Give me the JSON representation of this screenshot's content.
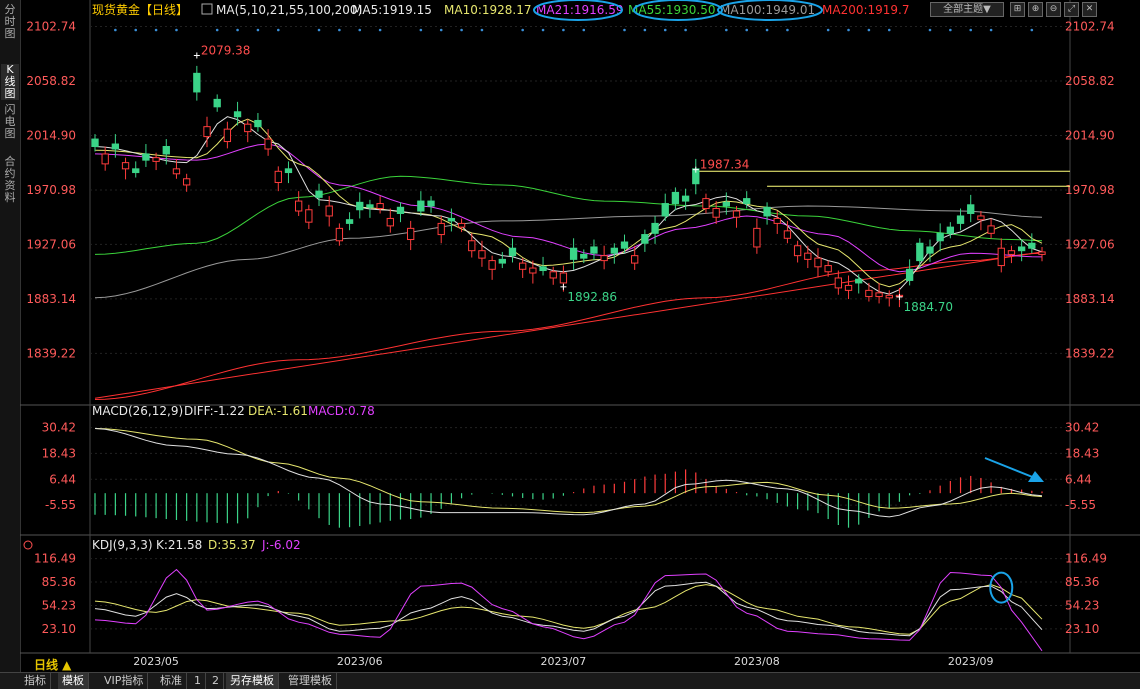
{
  "sidebar": {
    "tabs": [
      {
        "label": "分时图",
        "active": false
      },
      {
        "label": "K线图",
        "active": true
      },
      {
        "label": "闪电图",
        "active": false
      },
      {
        "label": "合约资料",
        "active": false
      }
    ]
  },
  "bottom_bar": {
    "tabs": [
      {
        "label": "指标",
        "active": false
      },
      {
        "label": "模板",
        "active": true
      },
      {
        "label": "VIP指标",
        "active": false
      },
      {
        "label": "标准",
        "active": false
      },
      {
        "label": "1",
        "active": false
      },
      {
        "label": "2",
        "active": false
      },
      {
        "label": "另存模板",
        "active": true
      },
      {
        "label": "管理模板",
        "active": false
      }
    ]
  },
  "period_label": "日线 ▲",
  "theme_button": "全部主题▼",
  "tool_icons": [
    "crosshair-icon",
    "zoom-icon",
    "zoom-out-icon",
    "fullscreen-icon",
    "close-icon"
  ],
  "colors": {
    "up": "#ff3c3c",
    "down": "#3bd488",
    "ma5": "#e0e0e0",
    "ma10": "#e6e66e",
    "ma21": "#e040ff",
    "ma55": "#3bd43b",
    "ma100": "#9a9a9a",
    "ma200": "#ff3232",
    "annotation": "#1aa3e8",
    "axis_text": "#ff5a5a",
    "bg": "#000000"
  },
  "chart_data": [
    {
      "type": "candlestick",
      "title": "现货黄金【日线】",
      "ma_legend": [
        {
          "label": "MA(5,10,21,55,100,200)",
          "color": "#e8e8e8"
        },
        {
          "label": "MA5:1919.15",
          "color": "#e8e8e8"
        },
        {
          "label": "MA10:1928.17",
          "color": "#e6e66e"
        },
        {
          "label": "MA21:1916.59",
          "color": "#e040ff"
        },
        {
          "label": "MA55:1930.50",
          "color": "#3bd43b"
        },
        {
          "label": "MA100:1949.01",
          "color": "#9a9a9a"
        },
        {
          "label": "MA200:1919.7",
          "color": "#ff3232"
        }
      ],
      "x_ticks": [
        "2023/05",
        "2023/06",
        "2023/07",
        "2023/08",
        "2023/09"
      ],
      "x_tick_index": [
        6,
        26,
        46,
        65,
        86
      ],
      "y_ticks": [
        2102.74,
        2058.82,
        2014.9,
        1970.98,
        1927.06,
        1883.14,
        1839.22
      ],
      "ylim": [
        1800,
        2108
      ],
      "annotations": [
        {
          "label": "2079.38",
          "index": 10,
          "value": 2079.38
        },
        {
          "label": "1987.34",
          "index": 59,
          "value": 1987.34
        },
        {
          "label": "1892.86",
          "index": 46,
          "value": 1892.86
        },
        {
          "label": "1884.70",
          "index": 79,
          "value": 1884.7
        }
      ],
      "resistance_lines": [
        {
          "value": 1986,
          "from_index": 59
        },
        {
          "value": 1974,
          "from_index": 66
        }
      ],
      "support_line": {
        "from": [
          0,
          1803
        ],
        "to": [
          93,
          1921
        ]
      },
      "close": [
        2006,
        2000,
        2004,
        1993,
        1985,
        1995,
        1997,
        2000,
        1988,
        1980,
        2050,
        2022,
        2038,
        2020,
        2030,
        2024,
        2022,
        2012,
        1986,
        1985,
        1962,
        1955,
        1965,
        1958,
        1940,
        1944,
        1955,
        1957,
        1960,
        1948,
        1952,
        1940,
        1954,
        1958,
        1944,
        1946,
        1944,
        1930,
        1922,
        1914,
        1912,
        1918,
        1912,
        1908,
        1906,
        1905,
        1904,
        1915,
        1916,
        1920,
        1918,
        1920,
        1924,
        1918,
        1928,
        1936,
        1950,
        1960,
        1962,
        1976,
        1964,
        1956,
        1958,
        1954,
        1960,
        1940,
        1950,
        1948,
        1938,
        1926,
        1920,
        1916,
        1910,
        1900,
        1894,
        1896,
        1890,
        1888,
        1886,
        1886,
        1898,
        1914,
        1920,
        1930,
        1936,
        1944,
        1952,
        1950,
        1942,
        1924,
        1922,
        1922,
        1924,
        1921
      ],
      "open_offsets": [
        6,
        -8,
        4,
        -5,
        3,
        5,
        -3,
        6,
        -4,
        -5,
        15,
        -8,
        6,
        -10,
        4,
        -6,
        5,
        -8,
        -9,
        3,
        -8,
        -10,
        5,
        -8,
        -10,
        3,
        6,
        2,
        -4,
        -6,
        5,
        -9,
        8,
        4,
        -9,
        2,
        -3,
        -8,
        -6,
        -7,
        3,
        6,
        -5,
        -4,
        3,
        -5,
        -8,
        9,
        3,
        5,
        -4,
        4,
        5,
        -6,
        7,
        8,
        10,
        9,
        4,
        12,
        -8,
        -7,
        3,
        -5,
        4,
        -15,
        7,
        -4,
        -6,
        -8,
        -5,
        -7,
        -5,
        -8,
        -4,
        3,
        -5,
        -3,
        -2,
        -1,
        9,
        14,
        5,
        6,
        5,
        6,
        7,
        -3,
        -6,
        -14,
        -3,
        3,
        4,
        -2
      ],
      "ma": {
        "ma5": {
          "pts": [
            [
              0,
              2006
            ],
            [
              9,
              1993
            ],
            [
              13,
              2030
            ],
            [
              18,
              2008
            ],
            [
              22,
              1963
            ],
            [
              28,
              1955
            ],
            [
              34,
              1950
            ],
            [
              40,
              1918
            ],
            [
              46,
              1905
            ],
            [
              52,
              1920
            ],
            [
              58,
              1958
            ],
            [
              62,
              1966
            ],
            [
              66,
              1952
            ],
            [
              72,
              1914
            ],
            [
              78,
              1887
            ],
            [
              84,
              1935
            ],
            [
              88,
              1948
            ],
            [
              93,
              1921
            ]
          ]
        },
        "ma10": {
          "pts": [
            [
              0,
              2003
            ],
            [
              10,
              1997
            ],
            [
              15,
              2028
            ],
            [
              20,
              1992
            ],
            [
              26,
              1957
            ],
            [
              32,
              1952
            ],
            [
              38,
              1935
            ],
            [
              44,
              1910
            ],
            [
              50,
              1915
            ],
            [
              56,
              1940
            ],
            [
              62,
              1962
            ],
            [
              66,
              1957
            ],
            [
              72,
              1925
            ],
            [
              78,
              1893
            ],
            [
              84,
              1925
            ],
            [
              90,
              1943
            ],
            [
              93,
              1928
            ]
          ]
        },
        "ma21": {
          "pts": [
            [
              0,
              2000
            ],
            [
              10,
              1995
            ],
            [
              17,
              2008
            ],
            [
              24,
              1975
            ],
            [
              32,
              1958
            ],
            [
              42,
              1933
            ],
            [
              50,
              1918
            ],
            [
              58,
              1940
            ],
            [
              64,
              1950
            ],
            [
              72,
              1935
            ],
            [
              79,
              1905
            ],
            [
              86,
              1920
            ],
            [
              93,
              1917
            ]
          ]
        },
        "ma55": {
          "pts": [
            [
              0,
              1919
            ],
            [
              10,
              1928
            ],
            [
              20,
              1965
            ],
            [
              30,
              1982
            ],
            [
              40,
              1975
            ],
            [
              50,
              1962
            ],
            [
              60,
              1958
            ],
            [
              70,
              1950
            ],
            [
              80,
              1938
            ],
            [
              90,
              1931
            ],
            [
              93,
              1930
            ]
          ]
        },
        "ma100": {
          "pts": [
            [
              0,
              1884
            ],
            [
              15,
              1915
            ],
            [
              25,
              1932
            ],
            [
              40,
              1946
            ],
            [
              55,
              1950
            ],
            [
              70,
              1958
            ],
            [
              85,
              1954
            ],
            [
              93,
              1949
            ]
          ]
        },
        "ma200": {
          "pts": [
            [
              0,
              1802
            ],
            [
              20,
              1834
            ],
            [
              40,
              1857
            ],
            [
              60,
              1884
            ],
            [
              76,
              1906
            ],
            [
              86,
              1914
            ],
            [
              93,
              1920
            ]
          ]
        }
      }
    },
    {
      "type": "bar",
      "title": "MACD(26,12,9)",
      "legend": [
        {
          "label": "MACD(26,12,9)",
          "color": "#e8e8e8"
        },
        {
          "label": "DIFF:-1.22",
          "color": "#e8e8e8"
        },
        {
          "label": "DEA:-1.61",
          "color": "#e6e66e"
        },
        {
          "label": "MACD:0.78",
          "color": "#e040ff"
        }
      ],
      "y_ticks": [
        30.42,
        18.43,
        6.44,
        -5.55
      ],
      "ylim": [
        -18,
        33
      ],
      "diff": {
        "pts": [
          [
            0,
            30
          ],
          [
            8,
            22
          ],
          [
            14,
            18
          ],
          [
            22,
            7
          ],
          [
            28,
            -5
          ],
          [
            34,
            -9
          ],
          [
            42,
            -9
          ],
          [
            48,
            -10
          ],
          [
            54,
            -5
          ],
          [
            58,
            4
          ],
          [
            62,
            6
          ],
          [
            68,
            2
          ],
          [
            74,
            -8
          ],
          [
            78,
            -11
          ],
          [
            82,
            -6
          ],
          [
            88,
            3
          ],
          [
            93,
            -1.2
          ]
        ]
      },
      "dea": {
        "pts": [
          [
            0,
            30
          ],
          [
            10,
            25
          ],
          [
            18,
            14
          ],
          [
            24,
            7
          ],
          [
            32,
            -4
          ],
          [
            40,
            -7
          ],
          [
            48,
            -9
          ],
          [
            54,
            -6
          ],
          [
            60,
            3
          ],
          [
            66,
            5
          ],
          [
            72,
            -1
          ],
          [
            78,
            -7
          ],
          [
            84,
            -5
          ],
          [
            90,
            0
          ],
          [
            93,
            -1.6
          ]
        ]
      },
      "hist_key": [
        [
          0,
          -10
        ],
        [
          14,
          -14
        ],
        [
          18,
          1
        ],
        [
          24,
          -16
        ],
        [
          31,
          -12
        ],
        [
          38,
          0
        ],
        [
          44,
          -3
        ],
        [
          50,
          4
        ],
        [
          56,
          9
        ],
        [
          58,
          11
        ],
        [
          62,
          2
        ],
        [
          64,
          -1
        ],
        [
          70,
          -8
        ],
        [
          74,
          -16
        ],
        [
          78,
          -7
        ],
        [
          80,
          -1
        ],
        [
          86,
          8
        ],
        [
          90,
          2
        ],
        [
          93,
          0.8
        ]
      ]
    },
    {
      "type": "line",
      "title": "KDJ(9,3,3)",
      "legend": [
        {
          "label": "KDJ(9,3,3)",
          "color": "#e8e8e8"
        },
        {
          "label": "K:21.58",
          "color": "#e8e8e8"
        },
        {
          "label": "D:35.37",
          "color": "#e6e66e"
        },
        {
          "label": "J:-6.02",
          "color": "#e040ff"
        }
      ],
      "y_ticks": [
        116.49,
        85.36,
        54.23,
        23.1
      ],
      "ylim": [
        -5,
        120
      ],
      "k": {
        "pts": [
          [
            0,
            50
          ],
          [
            4,
            40
          ],
          [
            8,
            70
          ],
          [
            11,
            50
          ],
          [
            16,
            55
          ],
          [
            20,
            40
          ],
          [
            24,
            20
          ],
          [
            28,
            24
          ],
          [
            32,
            48
          ],
          [
            36,
            66
          ],
          [
            40,
            40
          ],
          [
            44,
            28
          ],
          [
            48,
            20
          ],
          [
            52,
            40
          ],
          [
            56,
            80
          ],
          [
            60,
            85
          ],
          [
            64,
            52
          ],
          [
            68,
            34
          ],
          [
            72,
            28
          ],
          [
            76,
            18
          ],
          [
            80,
            14
          ],
          [
            84,
            75
          ],
          [
            88,
            80
          ],
          [
            91,
            52
          ],
          [
            93,
            22
          ]
        ]
      },
      "d": {
        "pts": [
          [
            0,
            60
          ],
          [
            6,
            45
          ],
          [
            10,
            62
          ],
          [
            14,
            52
          ],
          [
            20,
            44
          ],
          [
            24,
            28
          ],
          [
            30,
            34
          ],
          [
            36,
            52
          ],
          [
            42,
            40
          ],
          [
            48,
            24
          ],
          [
            54,
            50
          ],
          [
            60,
            82
          ],
          [
            66,
            50
          ],
          [
            70,
            38
          ],
          [
            74,
            26
          ],
          [
            80,
            16
          ],
          [
            84,
            60
          ],
          [
            88,
            82
          ],
          [
            91,
            64
          ],
          [
            93,
            36
          ]
        ]
      },
      "j": {
        "pts": [
          [
            0,
            35
          ],
          [
            4,
            30
          ],
          [
            8,
            102
          ],
          [
            11,
            48
          ],
          [
            16,
            60
          ],
          [
            20,
            32
          ],
          [
            24,
            16
          ],
          [
            28,
            12
          ],
          [
            32,
            80
          ],
          [
            36,
            84
          ],
          [
            40,
            50
          ],
          [
            44,
            26
          ],
          [
            48,
            10
          ],
          [
            52,
            32
          ],
          [
            56,
            94
          ],
          [
            60,
            96
          ],
          [
            64,
            44
          ],
          [
            68,
            20
          ],
          [
            72,
            16
          ],
          [
            76,
            10
          ],
          [
            80,
            8
          ],
          [
            84,
            98
          ],
          [
            88,
            94
          ],
          [
            91,
            32
          ],
          [
            93,
            -6
          ]
        ]
      }
    }
  ]
}
